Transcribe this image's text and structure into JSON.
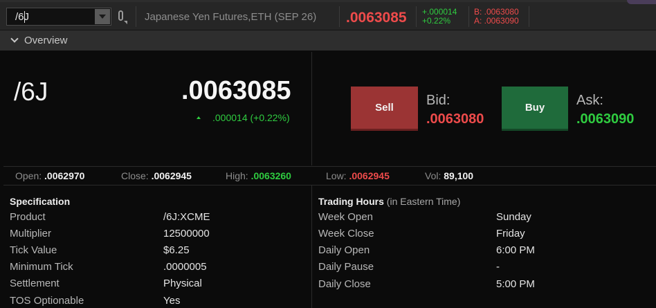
{
  "toolbar": {
    "symbol": "/6J",
    "description": "Japanese Yen Futures,ETH (SEP 26)",
    "last": ".0063085",
    "change": "+.000014",
    "change_pct": "+0.22%",
    "bid_small": "B: .0063080",
    "ask_small": "A: .0063090"
  },
  "overview": {
    "title": "Overview",
    "symbol": "/6J",
    "last": ".0063085",
    "change_line": ".000014 (+0.22%)",
    "sell_label": "Sell",
    "buy_label": "Buy",
    "bid_label": "Bid:",
    "bid_value": ".0063080",
    "ask_label": "Ask:",
    "ask_value": ".0063090"
  },
  "stats": {
    "open_label": "Open:",
    "open": ".0062970",
    "close_label": "Close:",
    "close": ".0062945",
    "high_label": "High:",
    "high": ".0063260",
    "low_label": "Low:",
    "low": ".0062945",
    "vol_label": "Vol:",
    "vol": "89,100"
  },
  "specification": {
    "title": "Specification",
    "rows": [
      {
        "label": "Product",
        "value": "/6J:XCME"
      },
      {
        "label": "Multiplier",
        "value": "12500000"
      },
      {
        "label": "Tick Value",
        "value": "$6.25"
      },
      {
        "label": "Minimum Tick",
        "value": ".0000005"
      },
      {
        "label": "Settlement",
        "value": "Physical"
      },
      {
        "label": "TOS Optionable",
        "value": "Yes"
      }
    ]
  },
  "trading_hours": {
    "title": "Trading Hours",
    "subtitle": "(in Eastern Time)",
    "rows": [
      {
        "label": "Week Open",
        "value": "Sunday"
      },
      {
        "label": "Week Close",
        "value": "Friday"
      },
      {
        "label": "Daily Open",
        "value": "6:00 PM"
      },
      {
        "label": "Daily Pause",
        "value": "-"
      },
      {
        "label": "Daily Close",
        "value": "5:00 PM"
      }
    ]
  },
  "colors": {
    "up": "#2fcc40",
    "down": "#ee4b4b",
    "sell_button": "#9b3434",
    "buy_button": "#1f6b3b"
  },
  "icons": [
    "chevron-down-icon",
    "link-icon",
    "dropdown-arrow-icon",
    "up-triangle-icon"
  ]
}
